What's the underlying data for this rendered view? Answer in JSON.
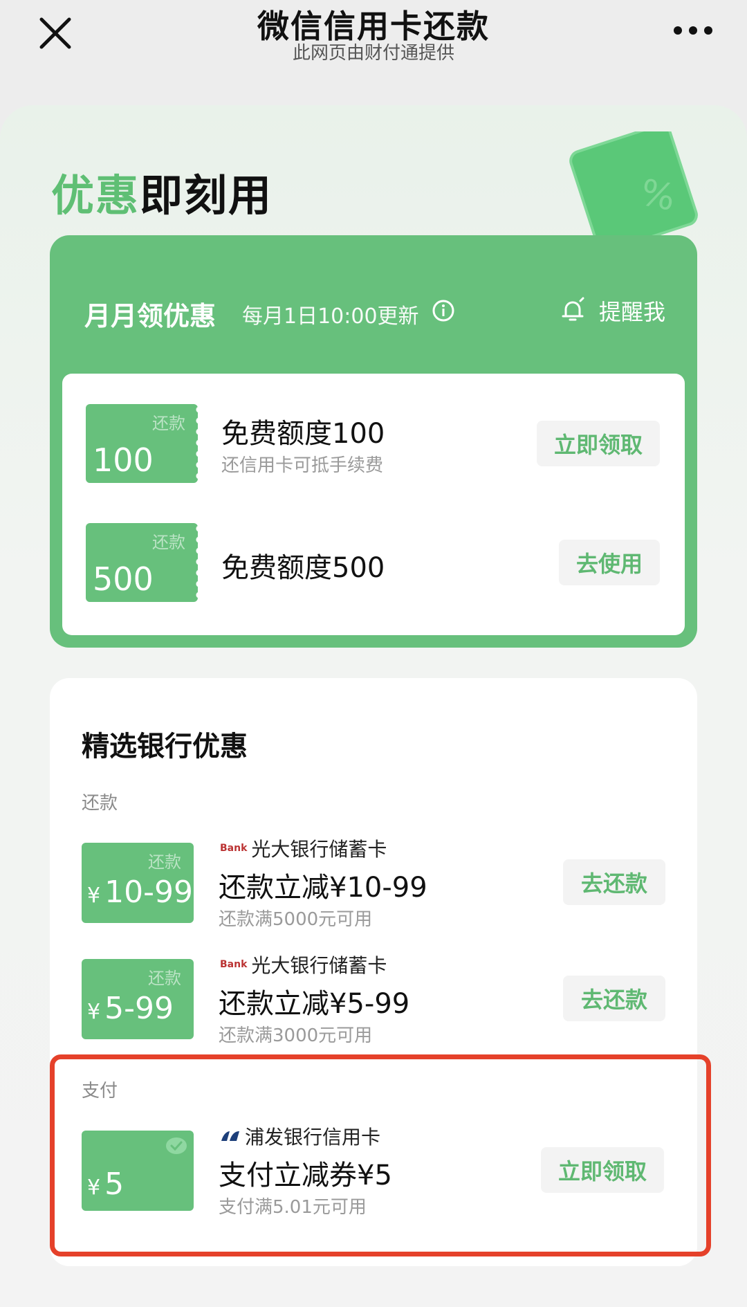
{
  "nav": {
    "title": "微信信用卡还款",
    "subtitle": "此网页由财付通提供"
  },
  "headline": {
    "accent": "优惠",
    "rest": "即刻用"
  },
  "monthly": {
    "title": "月月领优惠",
    "subtitle": "每月1日10:00更新",
    "remind_label": "提醒我",
    "items": [
      {
        "tag": "还款",
        "amount": "100",
        "title": "免费额度100",
        "desc": "还信用卡可抵手续费",
        "button": "立即领取"
      },
      {
        "tag": "还款",
        "amount": "500",
        "title": "免费额度500",
        "desc": "",
        "button": "去使用"
      }
    ]
  },
  "bank": {
    "title": "精选银行优惠",
    "repay_group_label": "还款",
    "pay_group_label": "支付",
    "repay_items": [
      {
        "tag": "还款",
        "yen": "¥",
        "amount": "10-99",
        "bank_logo": "Bank",
        "bank": "光大银行储蓄卡",
        "title": "还款立减¥10-99",
        "desc": "还款满5000元可用",
        "button": "去还款"
      },
      {
        "tag": "还款",
        "yen": "¥",
        "amount": "5-99",
        "bank_logo": "Bank",
        "bank": "光大银行储蓄卡",
        "title": "还款立减¥5-99",
        "desc": "还款满3000元可用",
        "button": "去还款"
      }
    ],
    "pay_item": {
      "yen": "¥",
      "amount": "5",
      "bank": "浦发银行信用卡",
      "title": "支付立减券¥5",
      "desc": "支付满5.01元可用",
      "button": "立即领取"
    }
  },
  "colors": {
    "accent": "#67c07c",
    "highlight": "#e5412a"
  },
  "icons": [
    "close-icon",
    "more-icon",
    "info-icon",
    "bell-icon",
    "check-icon"
  ]
}
